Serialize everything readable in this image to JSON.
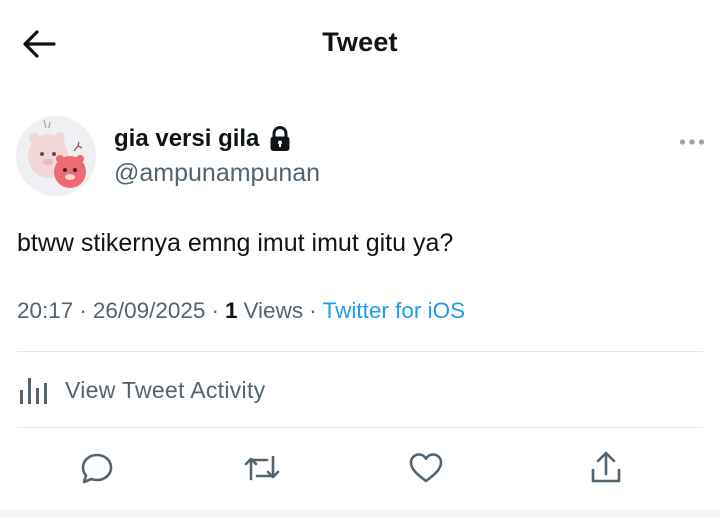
{
  "header": {
    "title": "Tweet"
  },
  "tweet": {
    "author": {
      "name": "gia versi gila",
      "handle": "@ampunampunan"
    },
    "text": "btww stikernya emng imut imut gitu ya?",
    "meta": {
      "time": "20:17",
      "date": "26/09/2025",
      "views_count": "1",
      "views_label": "Views",
      "source": "Twitter for iOS",
      "separator": "·"
    }
  },
  "activity": {
    "label": "View Tweet Activity"
  },
  "icons": {
    "back": "arrow-left-icon",
    "lock": "lock-icon",
    "more": "more-horizontal-icon",
    "activity": "bar-chart-icon",
    "reply": "reply-icon",
    "retweet": "retweet-icon",
    "like": "heart-icon",
    "share": "share-icon"
  },
  "colors": {
    "text": "#0f1419",
    "secondary": "#536471",
    "link": "#1d9bf0",
    "divider": "#e6e9ec"
  }
}
